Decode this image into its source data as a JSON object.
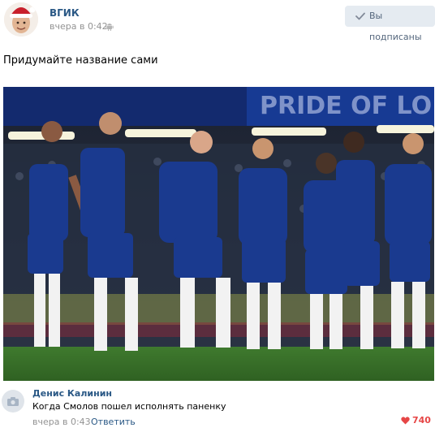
{
  "post": {
    "author": "ВГИК",
    "time": "вчера в 0:42",
    "subscribed_label": "Вы подписаны",
    "text": "Придумайте название сами",
    "photo_banner": "PRIDE OF LO"
  },
  "comment": {
    "author": "Денис Калинин",
    "text": "Когда Смолов пошел исполнять паненку",
    "time": "вчера в 0:43",
    "reply_label": "Ответить",
    "likes": "740"
  },
  "colors": {
    "link": "#2a5885",
    "muted": "#939393",
    "button_bg": "#e5ebf1",
    "like": "#e64646",
    "kit_blue": "#1a3a8f"
  },
  "icons": [
    "android-icon",
    "check-icon",
    "camera-icon",
    "heart-icon"
  ]
}
